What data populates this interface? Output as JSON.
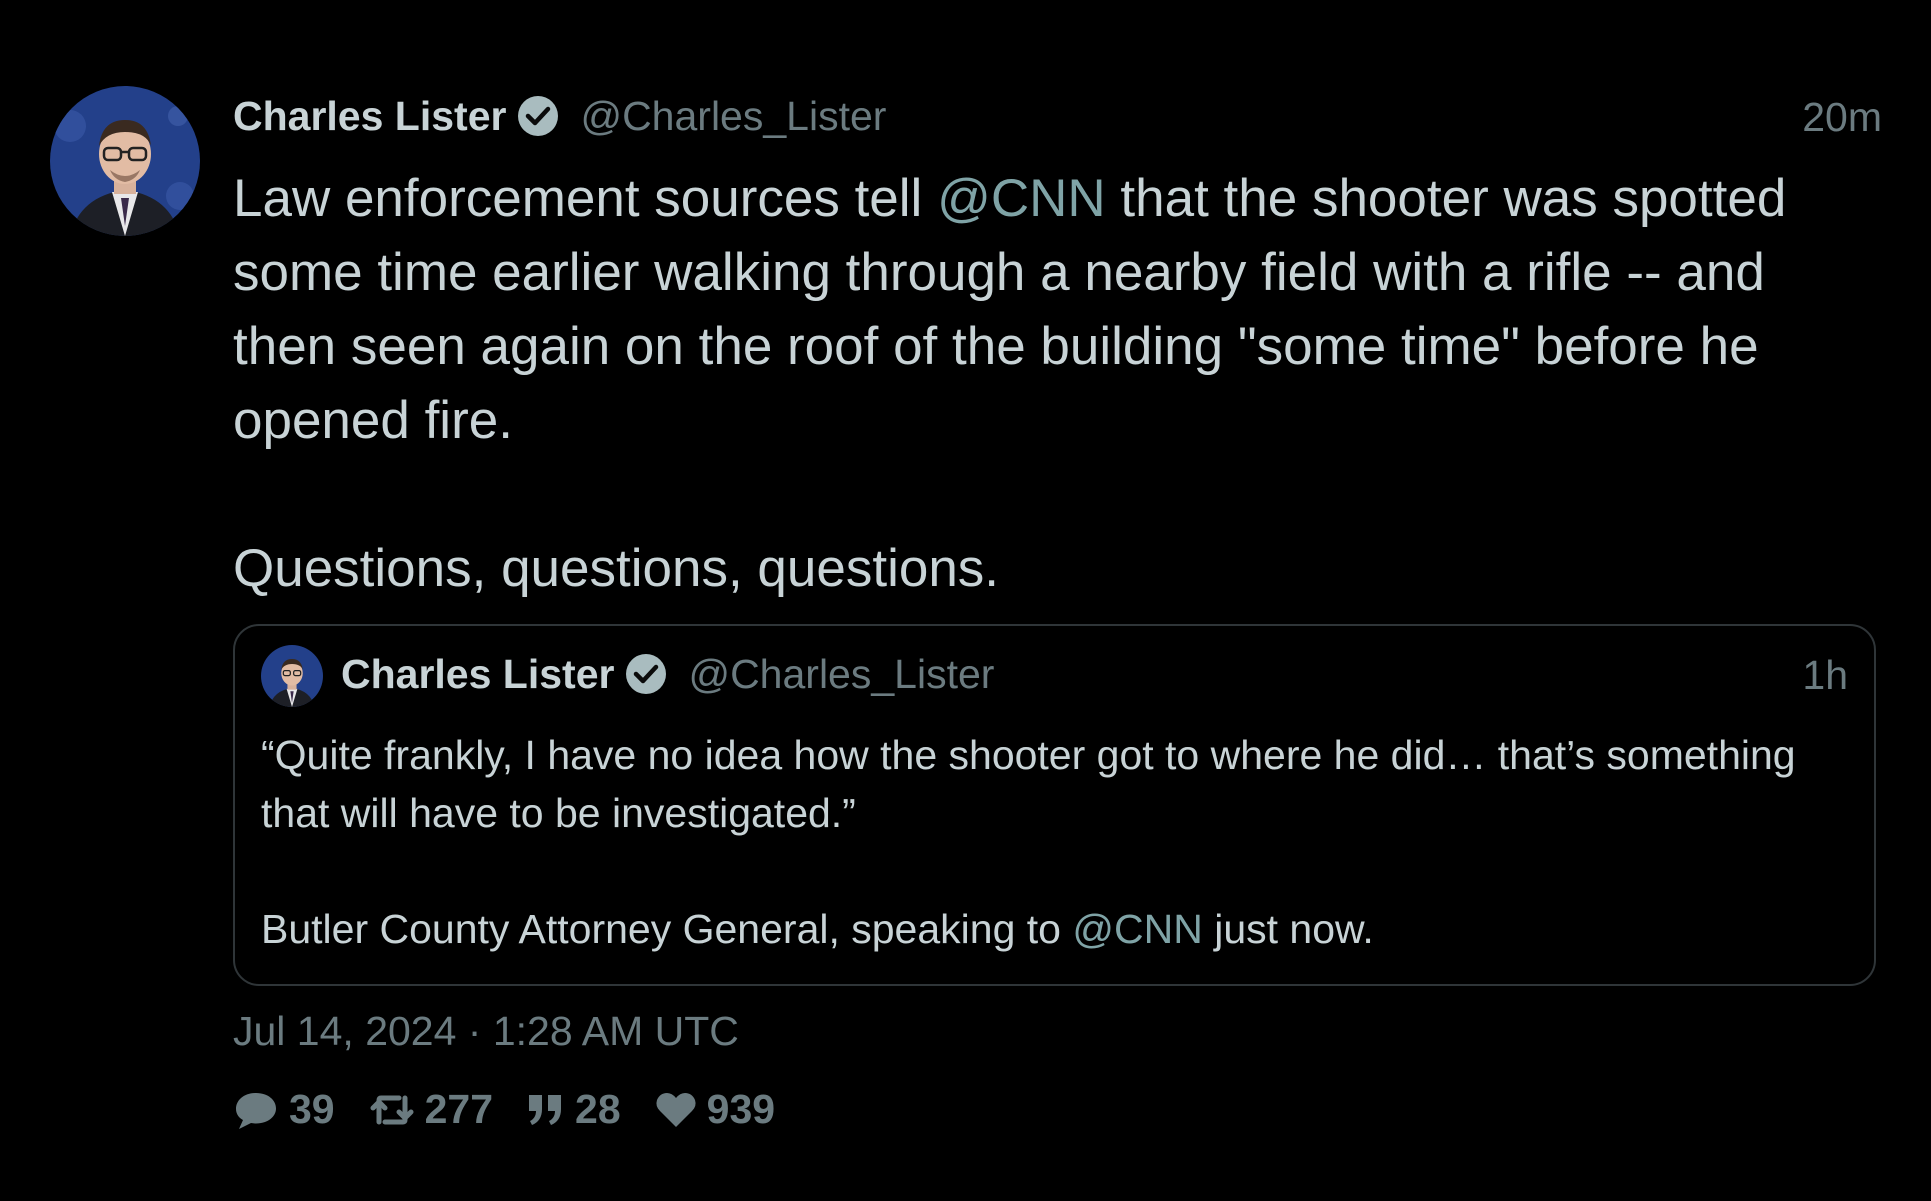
{
  "tweet": {
    "author_name": "Charles Lister",
    "author_handle": "@Charles_Lister",
    "time_ago": "20m",
    "body": {
      "line1_pre": "Law enforcement sources tell ",
      "line1_mention": "@CNN",
      "line1_post": " that the shooter was spotted some time earlier walking through a nearby field with a rifle -- and then seen again on the roof of the building \"some time\" before he opened fire.",
      "line2": "Questions, questions, questions."
    },
    "timestamp": "Jul 14, 2024 · 1:28 AM UTC",
    "stats": {
      "replies": "39",
      "retweets": "277",
      "quotes": "28",
      "likes": "939"
    }
  },
  "quoted_tweet": {
    "author_name": "Charles Lister",
    "author_handle": "@Charles_Lister",
    "time_ago": "1h",
    "body": {
      "quote": "“Quite frankly, I have no idea how the shooter got to where he did… that’s something that will have to be investigated.”",
      "attribution_pre": "Butler County Attorney General, speaking to ",
      "attribution_mention": "@CNN",
      "attribution_post": " just now."
    }
  },
  "colors": {
    "background": "#000000",
    "text": "#c8d3d6",
    "muted": "#6b7b80",
    "mention": "#7fa3a6",
    "verified_badge": "#a9bcbf",
    "border": "#2f3538"
  },
  "icons": {
    "reply": "speech-bubble-icon",
    "retweet": "retweet-icon",
    "quote": "quote-icon",
    "like": "heart-icon",
    "verified": "verified-badge-icon"
  }
}
